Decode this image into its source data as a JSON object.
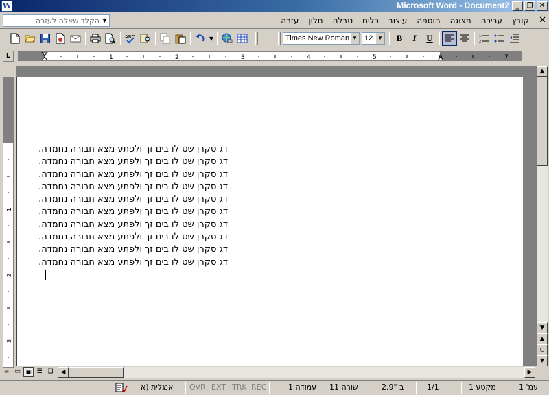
{
  "window": {
    "title": "Microsoft Word - Document2",
    "app_icon": "W"
  },
  "window_buttons": {
    "minimize": "_",
    "restore": "❐",
    "close": "✕"
  },
  "menubar": {
    "items": [
      "קובץ",
      "עריכה",
      "תצוגה",
      "הוספה",
      "עיצוב",
      "כלים",
      "טבלה",
      "חלון",
      "עזרה"
    ],
    "close_glyph": "✕",
    "ask_placeholder": "הקלד שאלה לעזרה"
  },
  "toolbar": {
    "font_name": "Times New Roman",
    "font_size": "12",
    "bold": "B",
    "italic": "I",
    "underline": "U"
  },
  "ruler": {
    "ticks": [
      "1",
      "2",
      "3",
      "4",
      "5",
      "6",
      "7"
    ]
  },
  "document": {
    "lines": [
      "דג סקרן שט לו בים זך ולפתע מצא חבורה נחמדה.",
      "דג סקרן שט לו בים זך ולפתע מצא חבורה נחמדה.",
      "דג סקרן שט לו בים זך ולפתע מצא חבורה נחמדה.",
      "דג סקרן שט לו בים זך ולפתע מצא חבורה נחמדה.",
      "דג סקרן שט לו בים זך ולפתע מצא חבורה נחמדה.",
      "דג סקרן שט לו בים זך ולפתע מצא חבורה נחמדה.",
      "דג סקרן שט לו בים זך ולפתע מצא חבורה נחמדה.",
      "דג סקרן שט לו בים זך ולפתע מצא חבורה נחמדה.",
      "דג סקרן שט לו בים זך ולפתע מצא חבורה נחמדה.",
      "דג סקרן שט לו בים זך ולפתע מצא חבורה נחמדה."
    ]
  },
  "statusbar": {
    "page": "עמ' 1",
    "section": "מקטע 1",
    "page_of": "1/1",
    "at": "ב \"2.9",
    "line": "שורה 11",
    "column": "עמודה 1",
    "rec": "REC",
    "trk": "TRK",
    "ext": "EXT",
    "ovr": "OVR",
    "language": "אנגלית (א"
  }
}
